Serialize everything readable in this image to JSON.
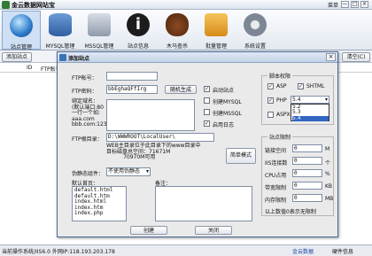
{
  "window": {
    "title": "金云数据网站宝",
    "menu_label": "菜单",
    "min_label": "—",
    "max_label": "□",
    "close_label": "×"
  },
  "toolbar": {
    "items": [
      {
        "label": "站点管理",
        "icon": "globe-icon"
      },
      {
        "label": "MYSQL管理",
        "icon": "database-icon"
      },
      {
        "label": "MSSQL管理",
        "icon": "server-icon"
      },
      {
        "label": "站点信息",
        "icon": "info-icon"
      },
      {
        "label": "木马查杀",
        "icon": "bull-icon"
      },
      {
        "label": "批量管理",
        "icon": "cart-icon"
      },
      {
        "label": "系统设置",
        "icon": "gear-icon"
      }
    ]
  },
  "subbar": {
    "add_label": "添加站点",
    "right_btn_label": "清空(C)"
  },
  "list": {
    "headers": [
      "ID",
      "FTP账号"
    ]
  },
  "dialog": {
    "title": "添加站点",
    "ftp_account_label": "FTP帐号：",
    "ftp_account_value": "",
    "ftp_password_label": "FTP密码：",
    "ftp_password_value": "bbEghaQFfIrg",
    "random_button": "随机生成",
    "bind_domain_label": "绑定域名：\n(默认端口:80\n一行一个如:\naaa.com\nbbb.com:123)",
    "ftp_dir_label": "FTP根目录：",
    "ftp_dir_value": "D:\\WWWROOT\\LocalUser\\",
    "disk_info": "WEB主目录位于此目录下的www目录中\n目标磁盘总空间：71671M\n          70970M可用",
    "simple_mode_button": "简单模式",
    "pseudo_static_label": "伪静态组件：",
    "pseudo_static_value": "不使用伪静态",
    "default_home_label": "默认首页：",
    "default_home_items": [
      "default.html",
      "default.htm",
      "index.html",
      "index.htm",
      "index.php"
    ],
    "remark_label": "备注：",
    "create_button": "创建",
    "close_button": "关闭",
    "checkboxes": [
      {
        "label": "启动站点",
        "checked": true
      },
      {
        "label": "创建MYSQL",
        "checked": false
      },
      {
        "label": "创建MSSQL",
        "checked": false
      },
      {
        "label": "启用日志",
        "checked": true
      }
    ],
    "script_group_title": "脚本权限",
    "asp_label": "ASP",
    "asp_checked": true,
    "shtml_label": "SHTML",
    "shtml_checked": true,
    "php_label": "PHP",
    "php_checked": true,
    "php_version": "5.4",
    "php_versions": [
      "5.2",
      "5.3",
      "5.4"
    ],
    "aspx_label": "ASPX",
    "aspx_checked": false,
    "limit_group_title": "站点限制",
    "limits": [
      {
        "label": "链接空间",
        "value": "0",
        "unit": "M"
      },
      {
        "label": "IIS连接数",
        "value": "0",
        "unit": "个"
      },
      {
        "label": "CPU占用",
        "value": "0",
        "unit": "%"
      },
      {
        "label": "带宽限制",
        "value": "0",
        "unit": "KB"
      },
      {
        "label": "内存限制",
        "value": "0",
        "unit": "MB"
      }
    ],
    "limit_note": "以上数值0表示无限制"
  },
  "status": {
    "left": "当前操作系统/IIS6.0 外网IP:118.193.203.178",
    "middle": "金云数据",
    "right": "硬件信息"
  }
}
